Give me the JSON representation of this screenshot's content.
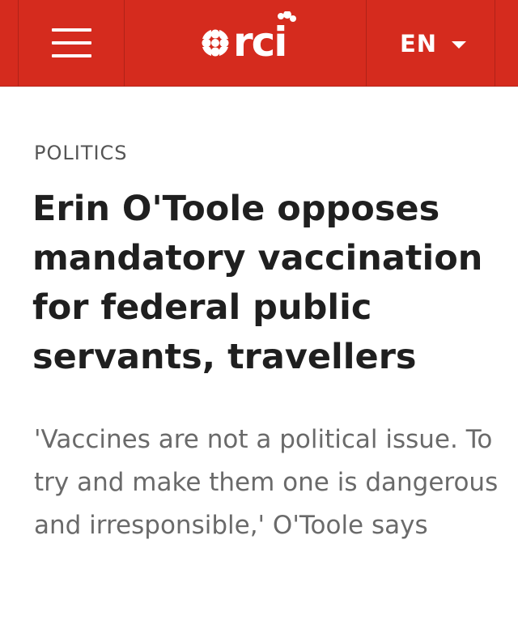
{
  "header": {
    "menu_icon": "hamburger-menu-icon",
    "logo_icon": "cbc-gem-icon",
    "logo_text": "rci",
    "language": "EN",
    "language_icon": "caret-down-icon",
    "brand_color": "#d52b1e"
  },
  "article": {
    "category": "POLITICS",
    "headline": "Erin O'Toole opposes mandatory vaccination for federal public servants, travellers",
    "subtitle": "'Vaccines are not a political issue. To try and make them one is dangerous and irresponsible,' O'Toole says"
  }
}
